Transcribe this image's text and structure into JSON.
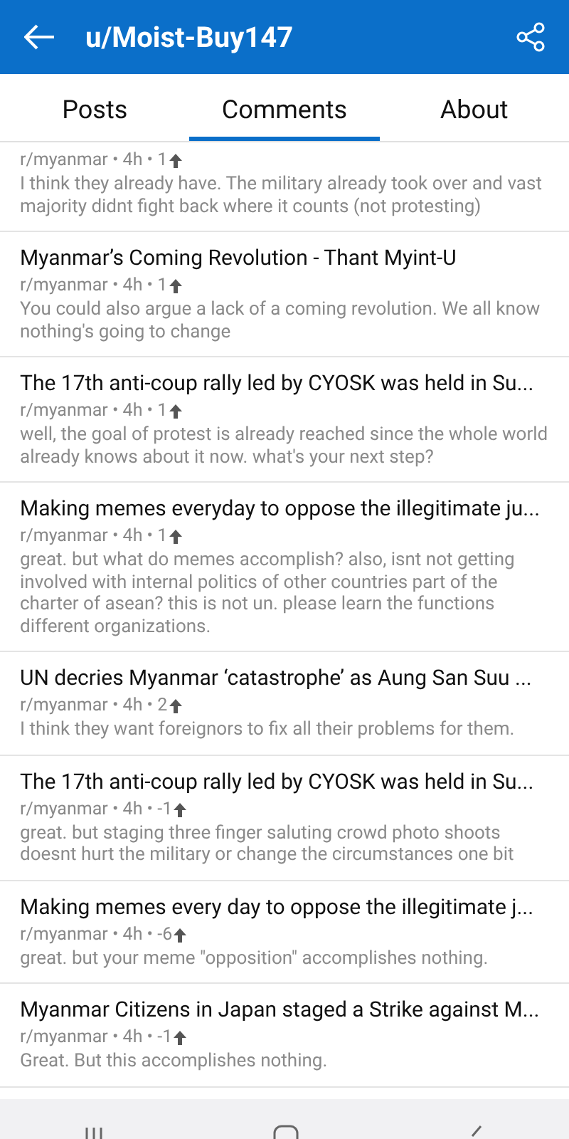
{
  "header": {
    "title": "u/Moist-Buy147"
  },
  "tabs": [
    {
      "label": "Posts",
      "selected": false
    },
    {
      "label": "Comments",
      "selected": true
    },
    {
      "label": "About",
      "selected": false
    }
  ],
  "comments": [
    {
      "meta": "r/myanmar • 4h • 1",
      "body": "I think they already have. The military already took over and vast majority didnt fight back where it counts (not protesting)"
    },
    {
      "title": "Myanmar’s Coming Revolution - Thant Myint-U",
      "meta": "r/myanmar • 4h • 1",
      "body": "You could also argue a lack of a coming revolution. We all know nothing's going to change"
    },
    {
      "title": "The 17th anti-coup rally led by CYOSK was held in Su...",
      "meta": "r/myanmar • 4h • 1",
      "body": "well, the goal of protest is already reached since the whole world already knows about it now. what's your next step?"
    },
    {
      "title": "Making memes everyday to oppose the illegitimate ju...",
      "meta": "r/myanmar • 4h • 1",
      "body": "great. but what do memes accomplish? also, isnt not getting involved with internal politics of other countries part of the charter of asean? this is not un. please learn the functions different organizations."
    },
    {
      "title": "UN decries Myanmar ‘catastrophe’ as Aung San Suu ...",
      "meta": "r/myanmar • 4h • 2",
      "body": "I think they want foreignors to fix all their problems for them."
    },
    {
      "title": "The 17th anti-coup rally led by CYOSK was held in Su...",
      "meta": "r/myanmar • 4h • -1",
      "body": "great. but staging three finger saluting crowd photo shoots doesnt hurt the military or change the circumstances one bit"
    },
    {
      "title": "Making memes every day to oppose the illegitimate j...",
      "meta": "r/myanmar • 4h • -6",
      "body": "great. but your meme \"opposition\" accomplishes nothing."
    },
    {
      "title": "Myanmar Citizens in Japan staged a Strike against M...",
      "meta": "r/myanmar • 4h • -1",
      "body": "Great. But this accomplishes nothing."
    }
  ]
}
